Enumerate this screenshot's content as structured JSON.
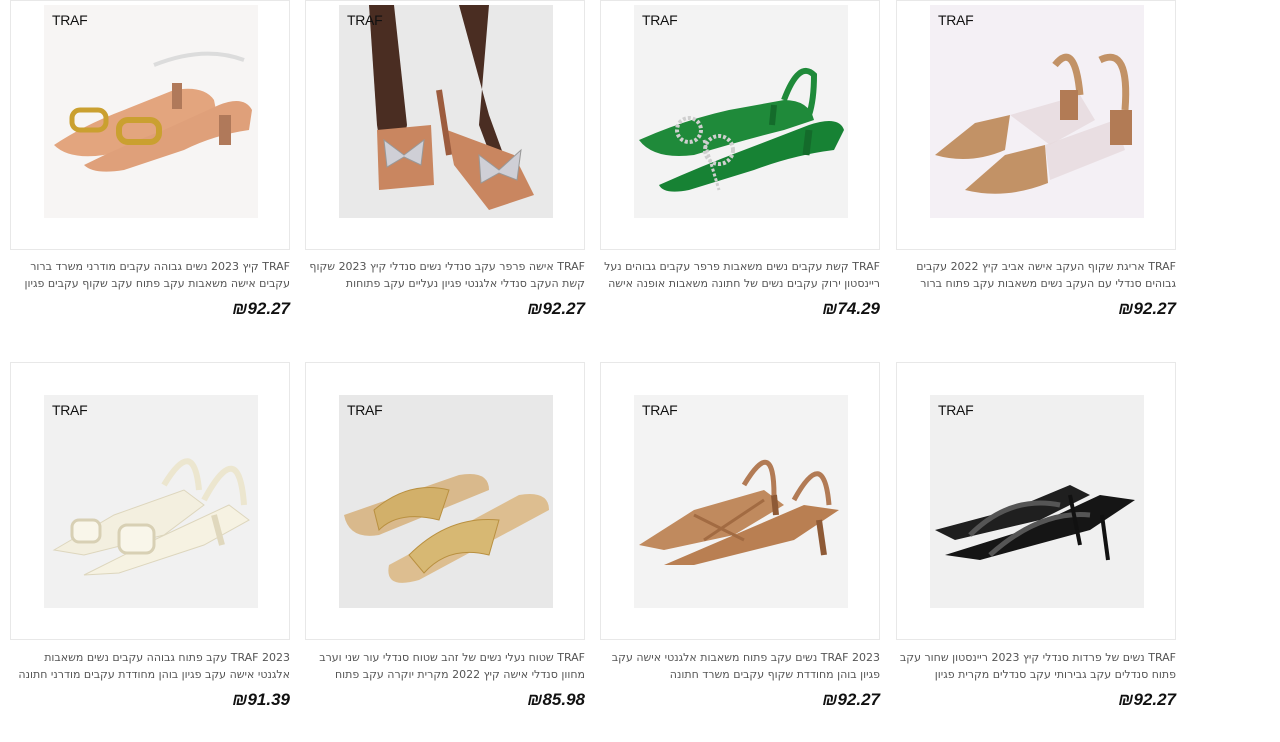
{
  "products": [
    {
      "brand": "TRAF",
      "title": "TRAF קיץ 2023 נשים גבוהה עקבים מודרני משרד ברור עקבים אישה משאבות עקב פתוח עקב שקוף עקבים פגיון חתונה נעל",
      "price": "₪92.27",
      "image_icon": "pointed-heel-gold-buckle-icon"
    },
    {
      "brand": "TRAF",
      "title": "TRAF אישה פרפר עקב סנדלי נשים סנדלי קיץ 2023 שקוף קשת העקב סנדלי אלגנטי פגיון נעליים עקב פתוחות",
      "price": "₪92.27",
      "image_icon": "bow-mule-sandal-icon"
    },
    {
      "brand": "TRAF",
      "title": "TRAF קשת עקבים נשים משאבות פרפר עקבים גבוהים נעל ריינסטון ירוק עקבים נשים של חתונה משאבות אופנה אישה קי...",
      "price": "₪74.29",
      "image_icon": "green-slingback-bow-icon"
    },
    {
      "brand": "TRAF",
      "title": "TRAF אריגת שקוף העקב אישה אביב קיץ 2022 עקבים גבוהים סנדלי עם העקב נשים משאבות עקב פתוח ברור בלוק עקבים",
      "price": "₪92.27",
      "image_icon": "woven-slingback-block-heel-icon"
    },
    {
      "brand": "TRAF",
      "title": "TRAF 2023 עקב פתוח גבוהה עקבים נשים משאבות אלגנטי אישה עקב פגיון בוהן מחודדת עקבים מודרני חתונה הכלה נעל...",
      "price": "₪91.39",
      "image_icon": "cream-slingback-buckle-icon"
    },
    {
      "brand": "TRAF",
      "title": "TRAF שטוח נעלי נשים של זהב שטוח סנדלי עור שני וערב מחוון סנדלי אישה קיץ 2022 מקרית יוקרה עקב פתוח נעליים",
      "price": "₪85.98",
      "image_icon": "gold-flat-slide-icon"
    },
    {
      "brand": "TRAF",
      "title": "TRAF 2023 נשים עקב פתוח משאבות אלגנטי אישה עקב פגיון בוהן מחודדת שקוף עקבים משרד חתונה",
      "price": "₪92.27",
      "image_icon": "tan-crossed-slingback-icon"
    },
    {
      "brand": "TRAF",
      "title": "TRAF נשים של פרדות סנדלי קיץ 2023 ריינסטון שחור עקב פתוח סנדלים עקב גבירותי עקב סנדלים מקרית פגיון עקבים...",
      "price": "₪92.27",
      "image_icon": "black-rhinestone-mule-icon"
    }
  ]
}
